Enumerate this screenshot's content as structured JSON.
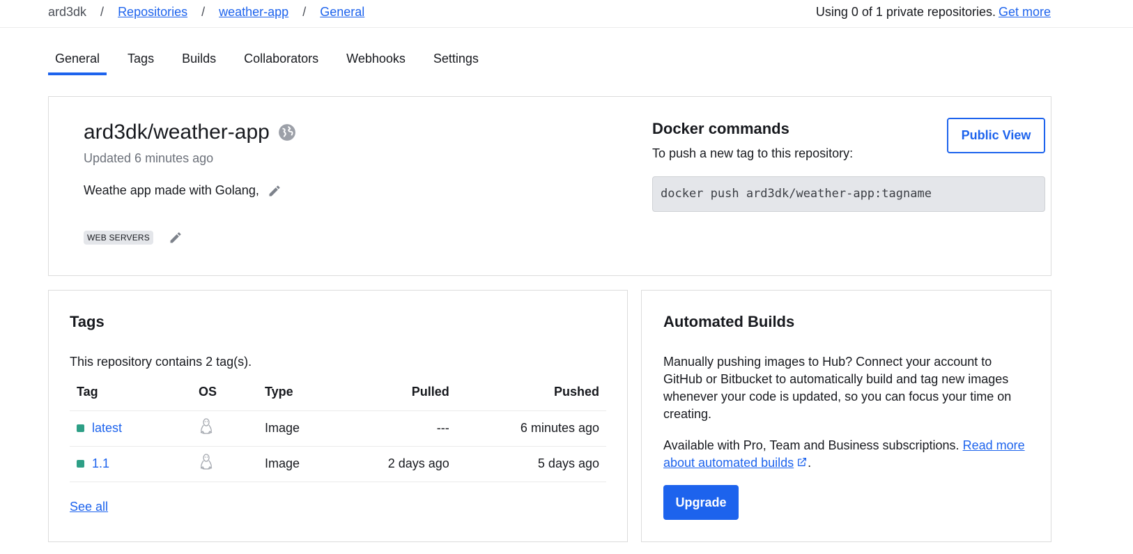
{
  "breadcrumb": {
    "user": "ard3dk",
    "separator": "/",
    "items": [
      "Repositories",
      "weather-app",
      "General"
    ]
  },
  "usage": {
    "text": "Using 0 of 1 private repositories.",
    "link": "Get more"
  },
  "tabs": [
    {
      "label": "General",
      "active": true
    },
    {
      "label": "Tags",
      "active": false
    },
    {
      "label": "Builds",
      "active": false
    },
    {
      "label": "Collaborators",
      "active": false
    },
    {
      "label": "Webhooks",
      "active": false
    },
    {
      "label": "Settings",
      "active": false
    }
  ],
  "repo": {
    "name": "ard3dk/weather-app",
    "updated": "Updated 6 minutes ago",
    "description": "Weathe app made with Golang,",
    "category": "WEB SERVERS"
  },
  "docker": {
    "title": "Docker commands",
    "subtitle": "To push a new tag to this repository:",
    "command": "docker push ard3dk/weather-app:tagname",
    "public_view": "Public View"
  },
  "tags_panel": {
    "title": "Tags",
    "summary": "This repository contains 2 tag(s).",
    "columns": [
      "Tag",
      "OS",
      "Type",
      "Pulled",
      "Pushed"
    ],
    "rows": [
      {
        "tag": "latest",
        "os": "linux-icon",
        "type": "Image",
        "pulled": "---",
        "pushed": "6 minutes ago"
      },
      {
        "tag": "1.1",
        "os": "linux-icon",
        "type": "Image",
        "pulled": "2 days ago",
        "pushed": "5 days ago"
      }
    ],
    "see_all": "See all"
  },
  "automated": {
    "title": "Automated Builds",
    "p1": "Manually pushing images to Hub? Connect your account to GitHub or Bitbucket to automatically build and tag new images whenever your code is updated, so you can focus your time on creating.",
    "p2_text": "Available with Pro, Team and Business subscriptions.",
    "p2_link": "Read more about automated builds",
    "p2_end": ".",
    "upgrade": "Upgrade"
  },
  "colors": {
    "accent": "#1d63ed",
    "tag_dot": "#2e9f86"
  }
}
